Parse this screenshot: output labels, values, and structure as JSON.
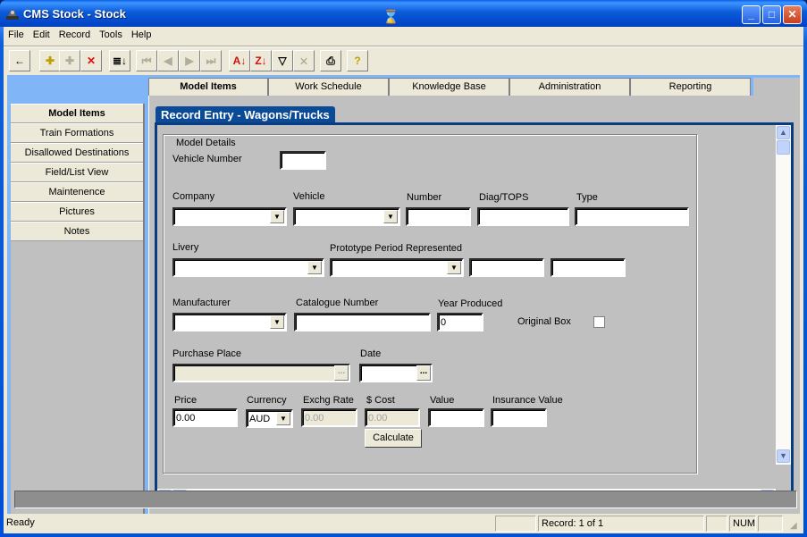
{
  "window": {
    "title": "CMS Stock - Stock",
    "controls": {
      "minimize": "_",
      "maximize": "□",
      "close": "✕"
    }
  },
  "menubar": [
    "File",
    "Edit",
    "Record",
    "Tools",
    "Help"
  ],
  "toolbar": [
    {
      "name": "back-icon",
      "glyph": "←",
      "enabled": true
    },
    {
      "name": "add-record-icon",
      "glyph": "✚",
      "enabled": true
    },
    {
      "name": "add-copy-record-icon",
      "glyph": "✚",
      "enabled": false
    },
    {
      "name": "delete-record-icon",
      "glyph": "✕",
      "enabled": true
    },
    {
      "name": "sort-list-icon",
      "glyph": "≣↓",
      "enabled": true
    },
    {
      "name": "first-record-icon",
      "glyph": "⏮",
      "enabled": false
    },
    {
      "name": "previous-record-icon",
      "glyph": "◀",
      "enabled": false
    },
    {
      "name": "next-record-icon",
      "glyph": "▶",
      "enabled": false
    },
    {
      "name": "last-record-icon",
      "glyph": "⏭",
      "enabled": false
    },
    {
      "name": "sort-ascending-icon",
      "glyph": "A↓",
      "enabled": true
    },
    {
      "name": "sort-descending-icon",
      "glyph": "Z↓",
      "enabled": true
    },
    {
      "name": "filter-icon",
      "glyph": "▽",
      "enabled": true
    },
    {
      "name": "remove-filter-icon",
      "glyph": "⨯",
      "enabled": false
    },
    {
      "name": "print-icon",
      "glyph": "⎙",
      "enabled": true
    },
    {
      "name": "help-icon",
      "glyph": "?",
      "enabled": true
    }
  ],
  "tabs": [
    {
      "label": "Model Items",
      "active": true
    },
    {
      "label": "Work Schedule",
      "active": false
    },
    {
      "label": "Knowledge Base",
      "active": false
    },
    {
      "label": "Administration",
      "active": false
    },
    {
      "label": "Reporting",
      "active": false
    }
  ],
  "sidebar": [
    {
      "label": "Model Items",
      "active": true
    },
    {
      "label": "Train Formations",
      "active": false
    },
    {
      "label": "Disallowed Destinations",
      "active": false
    },
    {
      "label": "Field/List View",
      "active": false
    },
    {
      "label": "Maintenence",
      "active": false
    },
    {
      "label": "Pictures",
      "active": false
    },
    {
      "label": "Notes",
      "active": false
    }
  ],
  "form": {
    "title": "Record Entry - Wagons/Trucks",
    "group_label": "Model Details",
    "labels": {
      "vehicle_number": "Vehicle Number",
      "company": "Company",
      "vehicle": "Vehicle",
      "number": "Number",
      "diag_tops": "Diag/TOPS",
      "type": "Type",
      "livery": "Livery",
      "prototype_period": "Prototype Period Represented",
      "manufacturer": "Manufacturer",
      "catalogue_number": "Catalogue Number",
      "year_produced": "Year Produced",
      "original_box": "Original Box",
      "purchase_place": "Purchase Place",
      "date": "Date",
      "price": "Price",
      "currency": "Currency",
      "exchg_rate": "Exchg Rate",
      "cost": "$ Cost",
      "value": "Value",
      "insurance_value": "Insurance Value"
    },
    "values": {
      "vehicle_number": "",
      "company": "",
      "vehicle": "",
      "number": "",
      "diag_tops": "",
      "type": "",
      "livery": "",
      "prototype_period": "",
      "period_from": "",
      "period_to": "",
      "manufacturer": "",
      "catalogue_number": "",
      "year_produced": "0",
      "original_box": false,
      "purchase_place": "",
      "date": "",
      "price": "0.00",
      "currency": "AUD",
      "exchg_rate": "0.00",
      "cost": "0.00",
      "value": "",
      "insurance_value": ""
    },
    "calculate_label": "Calculate",
    "ellipsis": "...",
    "dropdown_glyph": "▼"
  },
  "scroll": {
    "up": "▲",
    "down": "▼",
    "left": "◀",
    "right": "▶"
  },
  "statusbar": {
    "text": "Ready",
    "record": "Record: 1 of 1",
    "num": "NUM"
  }
}
